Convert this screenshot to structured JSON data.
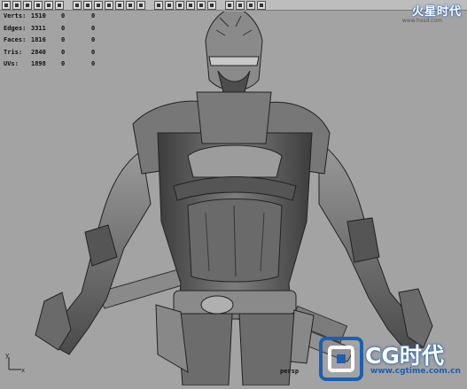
{
  "hud": {
    "rows": [
      {
        "label": "Verts:",
        "a": "1510",
        "b": "0",
        "c": "0"
      },
      {
        "label": "Edges:",
        "a": "3311",
        "b": "0",
        "c": "0"
      },
      {
        "label": "Faces:",
        "a": "1816",
        "b": "0",
        "c": "0"
      },
      {
        "label": "Tris:",
        "a": "2840",
        "b": "0",
        "c": "0"
      },
      {
        "label": "UVs:",
        "a": "1898",
        "b": "0",
        "c": "0"
      }
    ]
  },
  "toolbar": {
    "icons": [
      "select-icon",
      "lasso-icon",
      "paint-icon",
      "move-icon",
      "rotate-icon",
      "scale-icon",
      "manipulator-icon",
      "soft-icon",
      "camera-icon",
      "wireframe-icon",
      "shaded-icon",
      "textured-icon",
      "lights-icon",
      "layout-single-icon",
      "layout-four-icon",
      "layout-persp-icon",
      "layout-outliner-icon",
      "grid-icon",
      "snap-icon",
      "isolate-icon",
      "xray-icon",
      "hud-icon",
      "render-icon"
    ]
  },
  "viewport": {
    "camera_label": "persp",
    "axis_y": "y",
    "axis_x": "x"
  },
  "watermark": {
    "top_text": "火星时代",
    "top_url": "www.hxsd.com",
    "bottom_title": "CG时代",
    "bottom_url": "www.cgtime.com.cn"
  },
  "colors": {
    "viewport_bg": "#a3a3a3",
    "model_gray": "#6e6e6e",
    "brand_blue": "#1d5fb0"
  }
}
